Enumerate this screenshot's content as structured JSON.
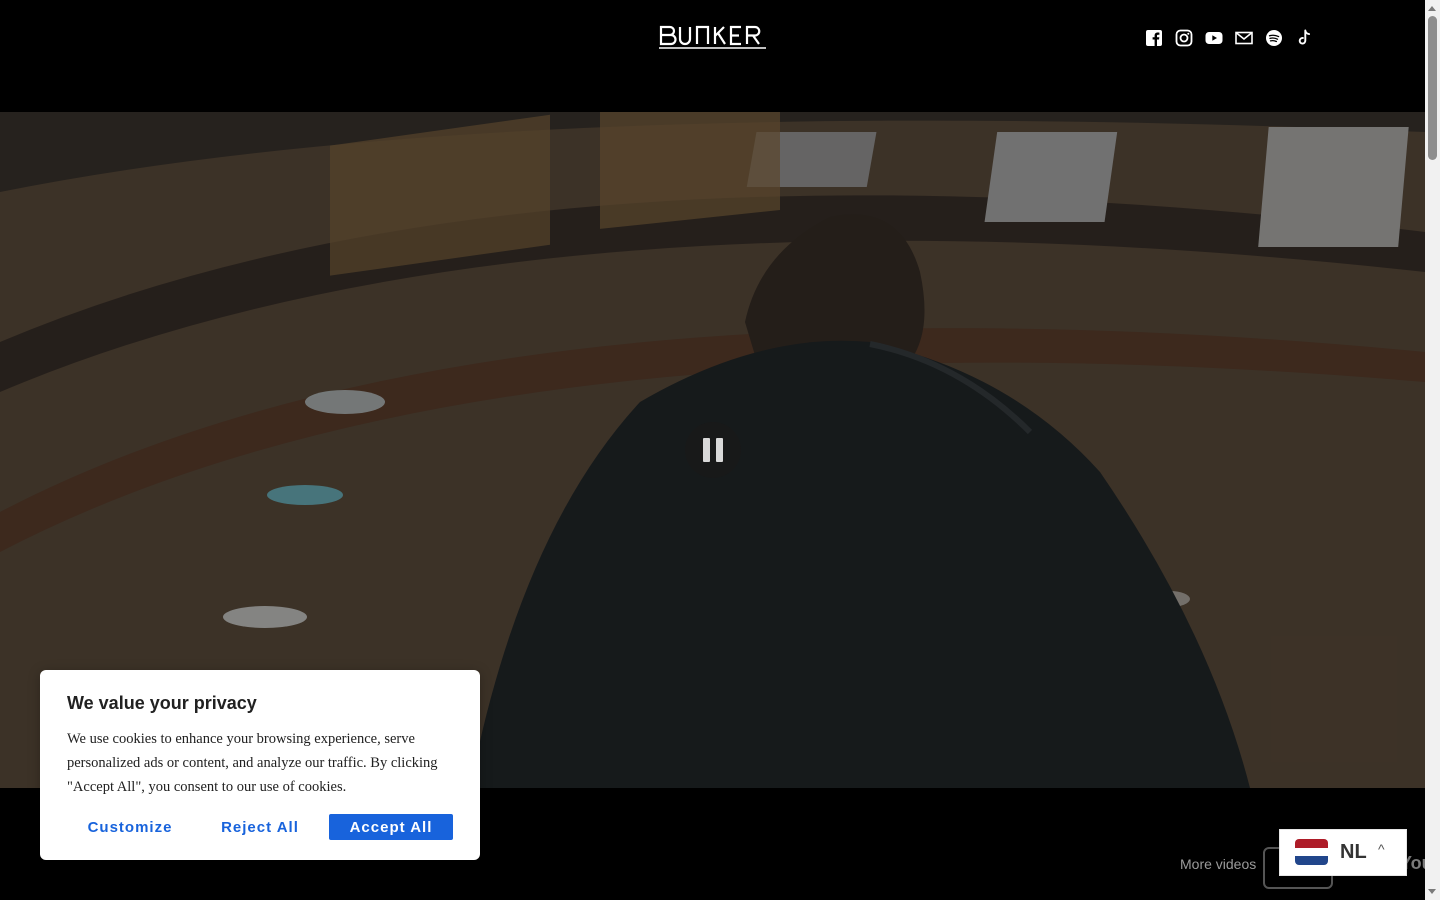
{
  "header": {
    "logo_text": "BUNKER",
    "socials": [
      {
        "name": "facebook-icon",
        "label": "Facebook"
      },
      {
        "name": "instagram-icon",
        "label": "Instagram"
      },
      {
        "name": "youtube-icon",
        "label": "YouTube"
      },
      {
        "name": "email-icon",
        "label": "Email"
      },
      {
        "name": "spotify-icon",
        "label": "Spotify"
      },
      {
        "name": "tiktok-icon",
        "label": "TikTok"
      }
    ]
  },
  "video": {
    "control_icon": "pause-icon",
    "more_videos_label": "More videos",
    "youtube_fragment": "You"
  },
  "cookie_banner": {
    "title": "We value your privacy",
    "text": "We use cookies to enhance your browsing experience, serve personalized ads or content, and analyze our traffic. By clicking \"Accept All\", you consent to our use of cookies.",
    "customize_label": "Customize",
    "reject_label": "Reject All",
    "accept_label": "Accept All"
  },
  "language": {
    "code": "NL",
    "flag_colors": [
      "#AE1C28",
      "#FFFFFF",
      "#21468B"
    ],
    "chevron": "^"
  },
  "colors": {
    "accent": "#1863dc",
    "background": "#000000"
  }
}
